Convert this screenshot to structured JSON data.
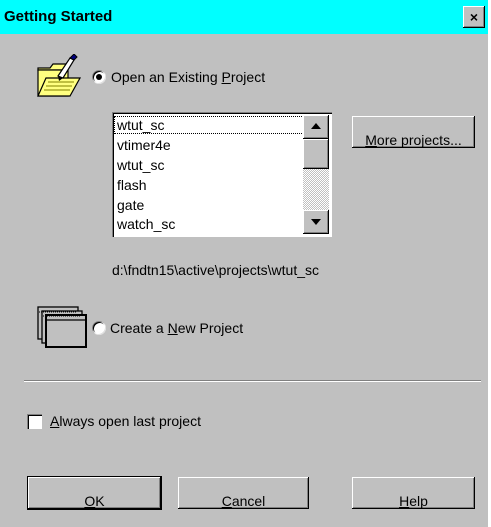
{
  "dialog": {
    "title": "Getting Started",
    "close_glyph": "×"
  },
  "open_existing": {
    "label_pre": "Open an Existing ",
    "label_mn": "P",
    "label_post": "roject",
    "checked": true
  },
  "project_list": {
    "items": [
      "wtut_sc",
      "vtimer4e",
      "wtut_sc",
      "flash",
      "gate",
      "watch_sc"
    ],
    "selected_index": 0
  },
  "more_projects_button": {
    "mn": "M",
    "rest": "ore projects..."
  },
  "project_path": "d:\\fndtn15\\active\\projects\\wtut_sc",
  "create_new": {
    "label_pre": "Create a ",
    "label_mn": "N",
    "label_post": "ew Project",
    "checked": false
  },
  "always_open": {
    "label_mn": "A",
    "label_rest": "lways open last project",
    "checked": false
  },
  "buttons": {
    "ok": {
      "mn": "O",
      "rest": "K"
    },
    "cancel": {
      "mn": "C",
      "rest": "ancel"
    },
    "help": {
      "mn": "H",
      "rest": "elp"
    }
  },
  "colors": {
    "titlebar": "#00ffff",
    "dialog_bg": "#c0c0c0",
    "folder": "#ffff80"
  },
  "icons": {
    "open_project": "open-folder-icon",
    "new_project": "stacked-windows-icon"
  }
}
